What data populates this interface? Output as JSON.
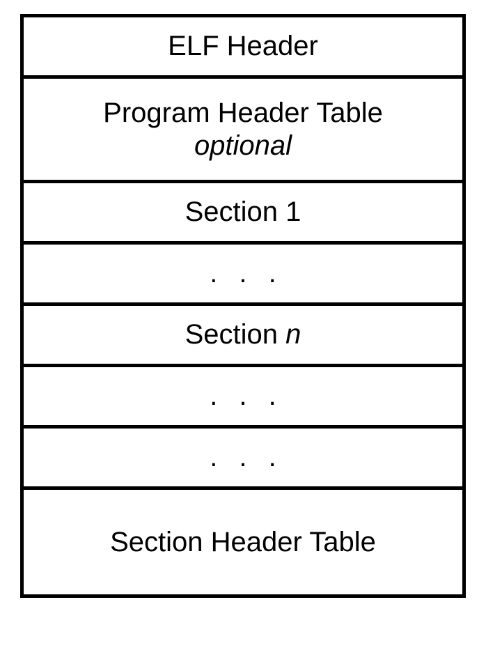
{
  "rows": {
    "elf_header": "ELF Header",
    "program_header_table": "Program Header Table",
    "program_header_table_sub": "optional",
    "section_1": "Section 1",
    "ellipsis_1": ". . .",
    "section_n_prefix": "Section ",
    "section_n_suffix": "n",
    "ellipsis_2": ". . .",
    "ellipsis_3": ". . .",
    "section_header_table": "Section Header Table"
  }
}
